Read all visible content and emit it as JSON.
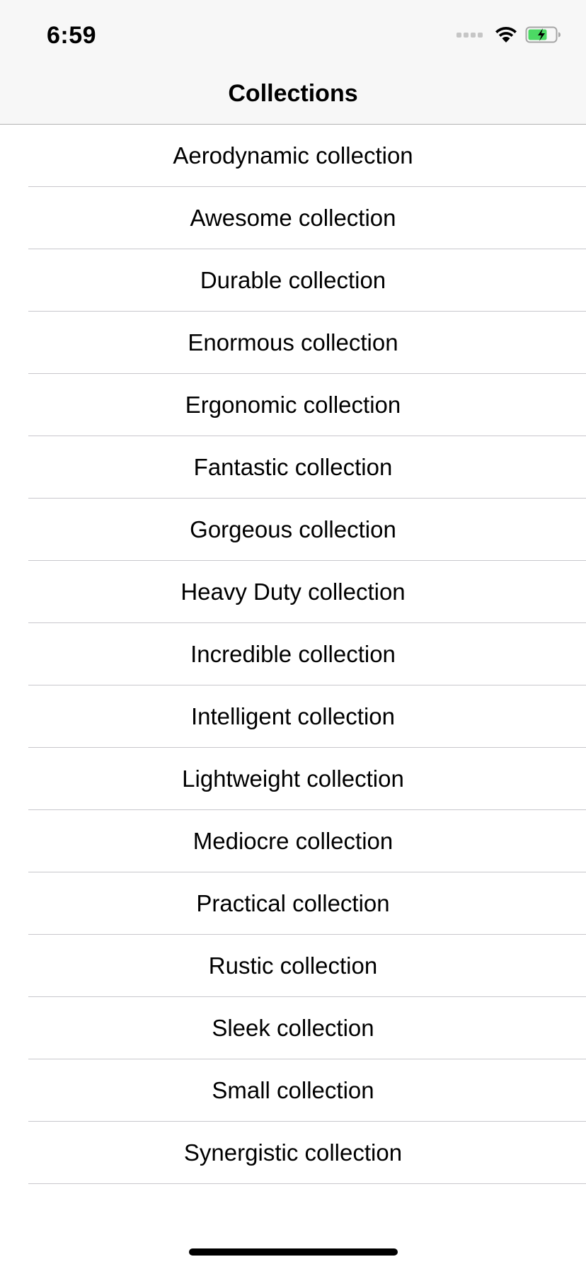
{
  "status_bar": {
    "time": "6:59",
    "icons": [
      "cellular-signal-icon",
      "wifi-icon",
      "battery-charging-icon"
    ],
    "battery_color": "#4cd964"
  },
  "nav": {
    "title": "Collections"
  },
  "collections": [
    {
      "label": "Aerodynamic collection"
    },
    {
      "label": "Awesome collection"
    },
    {
      "label": "Durable collection"
    },
    {
      "label": "Enormous collection"
    },
    {
      "label": "Ergonomic collection"
    },
    {
      "label": "Fantastic collection"
    },
    {
      "label": "Gorgeous collection"
    },
    {
      "label": "Heavy Duty collection"
    },
    {
      "label": "Incredible collection"
    },
    {
      "label": "Intelligent collection"
    },
    {
      "label": "Lightweight collection"
    },
    {
      "label": "Mediocre collection"
    },
    {
      "label": "Practical collection"
    },
    {
      "label": "Rustic collection"
    },
    {
      "label": "Sleek collection"
    },
    {
      "label": "Small collection"
    },
    {
      "label": "Synergistic collection"
    }
  ]
}
